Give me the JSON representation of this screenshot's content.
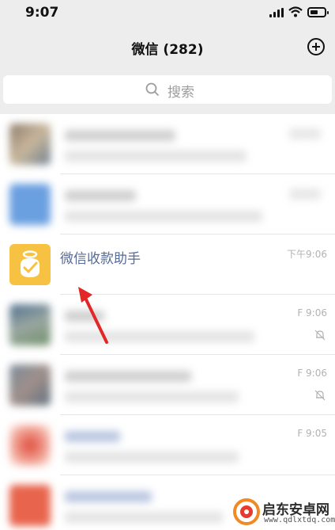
{
  "status_bar": {
    "time": "9:07"
  },
  "nav": {
    "title": "微信 (282)"
  },
  "search": {
    "placeholder": "搜索"
  },
  "chats": {
    "visible_chat": {
      "name": "微信收款助手",
      "time": "下午9:06"
    },
    "partial_times": [
      "F 9:06",
      "F 9:06",
      "F 9:05"
    ]
  },
  "watermark": {
    "name": "启东安卓网",
    "url": "www.qdlxtdq.com"
  },
  "colors": {
    "nav_background": "#ededed",
    "chat_name": "#576b95",
    "money_avatar": "#f7c242",
    "arrow": "#e32626"
  }
}
